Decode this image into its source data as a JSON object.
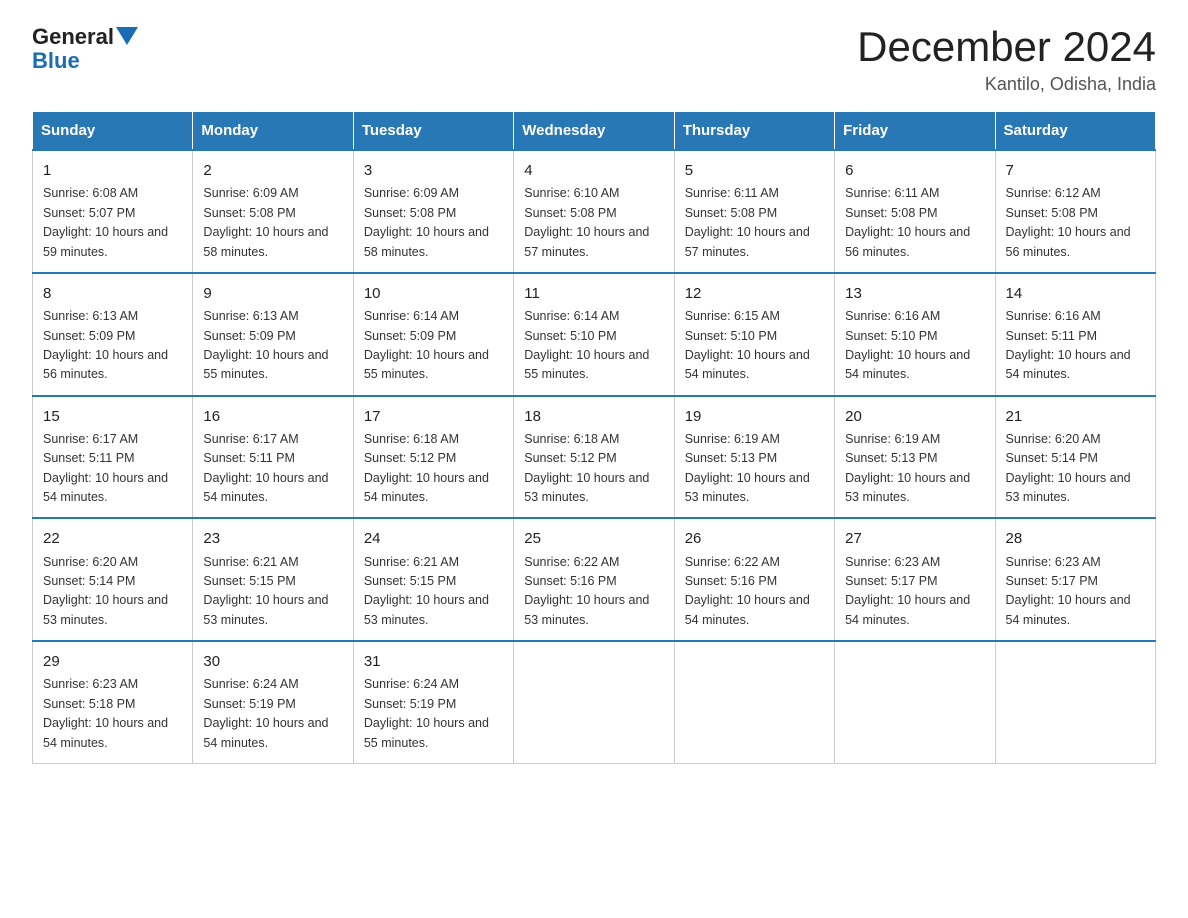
{
  "header": {
    "logo_general": "General",
    "logo_blue": "Blue",
    "title": "December 2024",
    "location": "Kantilo, Odisha, India"
  },
  "days_of_week": [
    "Sunday",
    "Monday",
    "Tuesday",
    "Wednesday",
    "Thursday",
    "Friday",
    "Saturday"
  ],
  "weeks": [
    [
      {
        "day": "1",
        "sunrise": "Sunrise: 6:08 AM",
        "sunset": "Sunset: 5:07 PM",
        "daylight": "Daylight: 10 hours and 59 minutes."
      },
      {
        "day": "2",
        "sunrise": "Sunrise: 6:09 AM",
        "sunset": "Sunset: 5:08 PM",
        "daylight": "Daylight: 10 hours and 58 minutes."
      },
      {
        "day": "3",
        "sunrise": "Sunrise: 6:09 AM",
        "sunset": "Sunset: 5:08 PM",
        "daylight": "Daylight: 10 hours and 58 minutes."
      },
      {
        "day": "4",
        "sunrise": "Sunrise: 6:10 AM",
        "sunset": "Sunset: 5:08 PM",
        "daylight": "Daylight: 10 hours and 57 minutes."
      },
      {
        "day": "5",
        "sunrise": "Sunrise: 6:11 AM",
        "sunset": "Sunset: 5:08 PM",
        "daylight": "Daylight: 10 hours and 57 minutes."
      },
      {
        "day": "6",
        "sunrise": "Sunrise: 6:11 AM",
        "sunset": "Sunset: 5:08 PM",
        "daylight": "Daylight: 10 hours and 56 minutes."
      },
      {
        "day": "7",
        "sunrise": "Sunrise: 6:12 AM",
        "sunset": "Sunset: 5:08 PM",
        "daylight": "Daylight: 10 hours and 56 minutes."
      }
    ],
    [
      {
        "day": "8",
        "sunrise": "Sunrise: 6:13 AM",
        "sunset": "Sunset: 5:09 PM",
        "daylight": "Daylight: 10 hours and 56 minutes."
      },
      {
        "day": "9",
        "sunrise": "Sunrise: 6:13 AM",
        "sunset": "Sunset: 5:09 PM",
        "daylight": "Daylight: 10 hours and 55 minutes."
      },
      {
        "day": "10",
        "sunrise": "Sunrise: 6:14 AM",
        "sunset": "Sunset: 5:09 PM",
        "daylight": "Daylight: 10 hours and 55 minutes."
      },
      {
        "day": "11",
        "sunrise": "Sunrise: 6:14 AM",
        "sunset": "Sunset: 5:10 PM",
        "daylight": "Daylight: 10 hours and 55 minutes."
      },
      {
        "day": "12",
        "sunrise": "Sunrise: 6:15 AM",
        "sunset": "Sunset: 5:10 PM",
        "daylight": "Daylight: 10 hours and 54 minutes."
      },
      {
        "day": "13",
        "sunrise": "Sunrise: 6:16 AM",
        "sunset": "Sunset: 5:10 PM",
        "daylight": "Daylight: 10 hours and 54 minutes."
      },
      {
        "day": "14",
        "sunrise": "Sunrise: 6:16 AM",
        "sunset": "Sunset: 5:11 PM",
        "daylight": "Daylight: 10 hours and 54 minutes."
      }
    ],
    [
      {
        "day": "15",
        "sunrise": "Sunrise: 6:17 AM",
        "sunset": "Sunset: 5:11 PM",
        "daylight": "Daylight: 10 hours and 54 minutes."
      },
      {
        "day": "16",
        "sunrise": "Sunrise: 6:17 AM",
        "sunset": "Sunset: 5:11 PM",
        "daylight": "Daylight: 10 hours and 54 minutes."
      },
      {
        "day": "17",
        "sunrise": "Sunrise: 6:18 AM",
        "sunset": "Sunset: 5:12 PM",
        "daylight": "Daylight: 10 hours and 54 minutes."
      },
      {
        "day": "18",
        "sunrise": "Sunrise: 6:18 AM",
        "sunset": "Sunset: 5:12 PM",
        "daylight": "Daylight: 10 hours and 53 minutes."
      },
      {
        "day": "19",
        "sunrise": "Sunrise: 6:19 AM",
        "sunset": "Sunset: 5:13 PM",
        "daylight": "Daylight: 10 hours and 53 minutes."
      },
      {
        "day": "20",
        "sunrise": "Sunrise: 6:19 AM",
        "sunset": "Sunset: 5:13 PM",
        "daylight": "Daylight: 10 hours and 53 minutes."
      },
      {
        "day": "21",
        "sunrise": "Sunrise: 6:20 AM",
        "sunset": "Sunset: 5:14 PM",
        "daylight": "Daylight: 10 hours and 53 minutes."
      }
    ],
    [
      {
        "day": "22",
        "sunrise": "Sunrise: 6:20 AM",
        "sunset": "Sunset: 5:14 PM",
        "daylight": "Daylight: 10 hours and 53 minutes."
      },
      {
        "day": "23",
        "sunrise": "Sunrise: 6:21 AM",
        "sunset": "Sunset: 5:15 PM",
        "daylight": "Daylight: 10 hours and 53 minutes."
      },
      {
        "day": "24",
        "sunrise": "Sunrise: 6:21 AM",
        "sunset": "Sunset: 5:15 PM",
        "daylight": "Daylight: 10 hours and 53 minutes."
      },
      {
        "day": "25",
        "sunrise": "Sunrise: 6:22 AM",
        "sunset": "Sunset: 5:16 PM",
        "daylight": "Daylight: 10 hours and 53 minutes."
      },
      {
        "day": "26",
        "sunrise": "Sunrise: 6:22 AM",
        "sunset": "Sunset: 5:16 PM",
        "daylight": "Daylight: 10 hours and 54 minutes."
      },
      {
        "day": "27",
        "sunrise": "Sunrise: 6:23 AM",
        "sunset": "Sunset: 5:17 PM",
        "daylight": "Daylight: 10 hours and 54 minutes."
      },
      {
        "day": "28",
        "sunrise": "Sunrise: 6:23 AM",
        "sunset": "Sunset: 5:17 PM",
        "daylight": "Daylight: 10 hours and 54 minutes."
      }
    ],
    [
      {
        "day": "29",
        "sunrise": "Sunrise: 6:23 AM",
        "sunset": "Sunset: 5:18 PM",
        "daylight": "Daylight: 10 hours and 54 minutes."
      },
      {
        "day": "30",
        "sunrise": "Sunrise: 6:24 AM",
        "sunset": "Sunset: 5:19 PM",
        "daylight": "Daylight: 10 hours and 54 minutes."
      },
      {
        "day": "31",
        "sunrise": "Sunrise: 6:24 AM",
        "sunset": "Sunset: 5:19 PM",
        "daylight": "Daylight: 10 hours and 55 minutes."
      },
      null,
      null,
      null,
      null
    ]
  ]
}
